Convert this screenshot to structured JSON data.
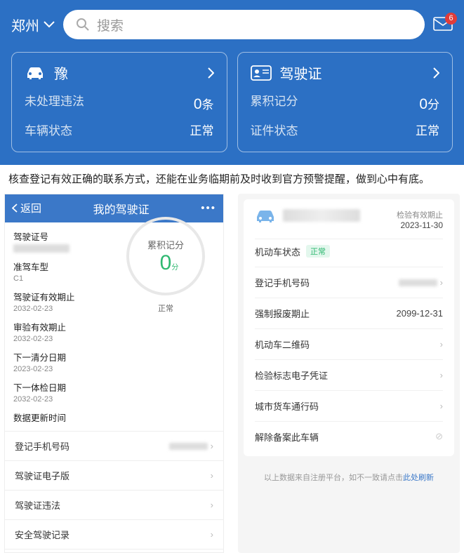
{
  "header": {
    "city": "郑州",
    "search_placeholder": "搜索",
    "mail_badge": "6"
  },
  "cards": {
    "vehicle": {
      "title_prefix": "豫",
      "line1_label": "未处理违法",
      "line1_value": "0",
      "line1_unit": "条",
      "line2_label": "车辆状态",
      "line2_value": "正常"
    },
    "license": {
      "title": "驾驶证",
      "line1_label": "累积记分",
      "line1_value": "0",
      "line1_unit": "分",
      "line2_label": "证件状态",
      "line2_value": "正常"
    }
  },
  "description": "核查登记有效正确的联系方式，还能在业务临期前及时收到官方预警提醒，做到心中有底。",
  "lpanel": {
    "back": "返回",
    "title": "我的驾驶证",
    "fields": {
      "license_no_label": "驾驶证号",
      "vehicle_type_label": "准驾车型",
      "vehicle_type_value": "C1",
      "expiry_label": "驾驶证有效期止",
      "expiry_value": "2032-02-23",
      "review_label": "审验有效期止",
      "review_value": "2032-02-23",
      "next_clear_label": "下一清分日期",
      "next_clear_value": "2023-02-23",
      "next_check_label": "下一体检日期",
      "next_check_value": "2032-02-23",
      "update_label": "数据更新时间"
    },
    "gauge": {
      "title": "累积记分",
      "value": "0",
      "unit": "分",
      "status": "正常"
    },
    "nav": [
      "登记手机号码",
      "驾驶证电子版",
      "驾驶证违法",
      "安全驾驶记录"
    ]
  },
  "rpanel": {
    "inspect_label": "检验有效期止",
    "inspect_date": "2023-11-30",
    "status_label": "机动车状态",
    "status_value": "正常",
    "rows": {
      "phone_label": "登记手机号码",
      "scrap_label": "强制报废期止",
      "scrap_value": "2099-12-31",
      "qr_label": "机动车二维码",
      "cert_label": "检验标志电子凭证",
      "pass_label": "城市货车通行码",
      "unbind_label": "解除备案此车辆"
    },
    "footnote_prefix": "以上数据来自注册平台，如不一致请点击",
    "footnote_link": "此处刷新"
  }
}
